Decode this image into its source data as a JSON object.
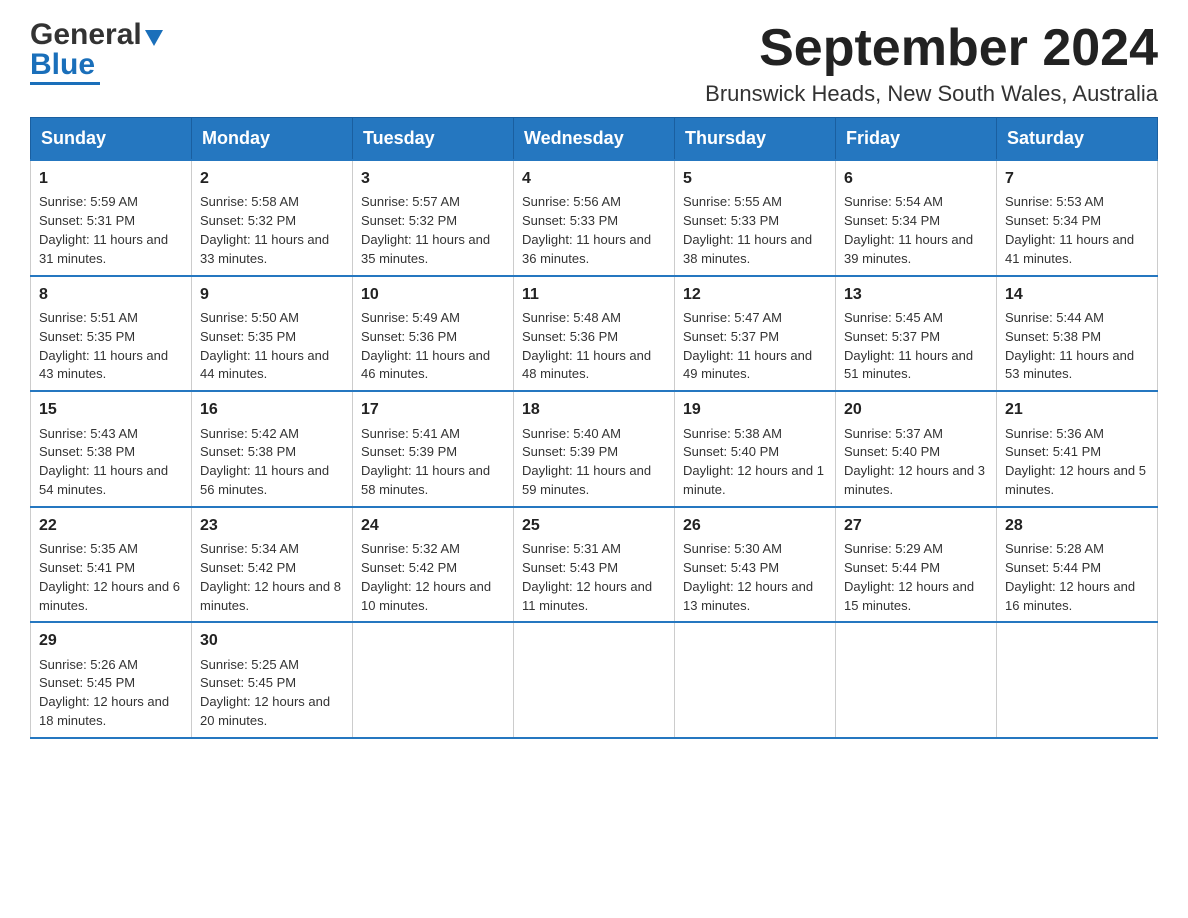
{
  "logo": {
    "text_general": "General",
    "text_blue": "Blue"
  },
  "title": "September 2024",
  "location": "Brunswick Heads, New South Wales, Australia",
  "days_of_week": [
    "Sunday",
    "Monday",
    "Tuesday",
    "Wednesday",
    "Thursday",
    "Friday",
    "Saturday"
  ],
  "weeks": [
    [
      {
        "day": "1",
        "sunrise": "5:59 AM",
        "sunset": "5:31 PM",
        "daylight": "11 hours and 31 minutes."
      },
      {
        "day": "2",
        "sunrise": "5:58 AM",
        "sunset": "5:32 PM",
        "daylight": "11 hours and 33 minutes."
      },
      {
        "day": "3",
        "sunrise": "5:57 AM",
        "sunset": "5:32 PM",
        "daylight": "11 hours and 35 minutes."
      },
      {
        "day": "4",
        "sunrise": "5:56 AM",
        "sunset": "5:33 PM",
        "daylight": "11 hours and 36 minutes."
      },
      {
        "day": "5",
        "sunrise": "5:55 AM",
        "sunset": "5:33 PM",
        "daylight": "11 hours and 38 minutes."
      },
      {
        "day": "6",
        "sunrise": "5:54 AM",
        "sunset": "5:34 PM",
        "daylight": "11 hours and 39 minutes."
      },
      {
        "day": "7",
        "sunrise": "5:53 AM",
        "sunset": "5:34 PM",
        "daylight": "11 hours and 41 minutes."
      }
    ],
    [
      {
        "day": "8",
        "sunrise": "5:51 AM",
        "sunset": "5:35 PM",
        "daylight": "11 hours and 43 minutes."
      },
      {
        "day": "9",
        "sunrise": "5:50 AM",
        "sunset": "5:35 PM",
        "daylight": "11 hours and 44 minutes."
      },
      {
        "day": "10",
        "sunrise": "5:49 AM",
        "sunset": "5:36 PM",
        "daylight": "11 hours and 46 minutes."
      },
      {
        "day": "11",
        "sunrise": "5:48 AM",
        "sunset": "5:36 PM",
        "daylight": "11 hours and 48 minutes."
      },
      {
        "day": "12",
        "sunrise": "5:47 AM",
        "sunset": "5:37 PM",
        "daylight": "11 hours and 49 minutes."
      },
      {
        "day": "13",
        "sunrise": "5:45 AM",
        "sunset": "5:37 PM",
        "daylight": "11 hours and 51 minutes."
      },
      {
        "day": "14",
        "sunrise": "5:44 AM",
        "sunset": "5:38 PM",
        "daylight": "11 hours and 53 minutes."
      }
    ],
    [
      {
        "day": "15",
        "sunrise": "5:43 AM",
        "sunset": "5:38 PM",
        "daylight": "11 hours and 54 minutes."
      },
      {
        "day": "16",
        "sunrise": "5:42 AM",
        "sunset": "5:38 PM",
        "daylight": "11 hours and 56 minutes."
      },
      {
        "day": "17",
        "sunrise": "5:41 AM",
        "sunset": "5:39 PM",
        "daylight": "11 hours and 58 minutes."
      },
      {
        "day": "18",
        "sunrise": "5:40 AM",
        "sunset": "5:39 PM",
        "daylight": "11 hours and 59 minutes."
      },
      {
        "day": "19",
        "sunrise": "5:38 AM",
        "sunset": "5:40 PM",
        "daylight": "12 hours and 1 minute."
      },
      {
        "day": "20",
        "sunrise": "5:37 AM",
        "sunset": "5:40 PM",
        "daylight": "12 hours and 3 minutes."
      },
      {
        "day": "21",
        "sunrise": "5:36 AM",
        "sunset": "5:41 PM",
        "daylight": "12 hours and 5 minutes."
      }
    ],
    [
      {
        "day": "22",
        "sunrise": "5:35 AM",
        "sunset": "5:41 PM",
        "daylight": "12 hours and 6 minutes."
      },
      {
        "day": "23",
        "sunrise": "5:34 AM",
        "sunset": "5:42 PM",
        "daylight": "12 hours and 8 minutes."
      },
      {
        "day": "24",
        "sunrise": "5:32 AM",
        "sunset": "5:42 PM",
        "daylight": "12 hours and 10 minutes."
      },
      {
        "day": "25",
        "sunrise": "5:31 AM",
        "sunset": "5:43 PM",
        "daylight": "12 hours and 11 minutes."
      },
      {
        "day": "26",
        "sunrise": "5:30 AM",
        "sunset": "5:43 PM",
        "daylight": "12 hours and 13 minutes."
      },
      {
        "day": "27",
        "sunrise": "5:29 AM",
        "sunset": "5:44 PM",
        "daylight": "12 hours and 15 minutes."
      },
      {
        "day": "28",
        "sunrise": "5:28 AM",
        "sunset": "5:44 PM",
        "daylight": "12 hours and 16 minutes."
      }
    ],
    [
      {
        "day": "29",
        "sunrise": "5:26 AM",
        "sunset": "5:45 PM",
        "daylight": "12 hours and 18 minutes."
      },
      {
        "day": "30",
        "sunrise": "5:25 AM",
        "sunset": "5:45 PM",
        "daylight": "12 hours and 20 minutes."
      },
      null,
      null,
      null,
      null,
      null
    ]
  ],
  "labels": {
    "sunrise": "Sunrise:",
    "sunset": "Sunset:",
    "daylight": "Daylight:"
  }
}
